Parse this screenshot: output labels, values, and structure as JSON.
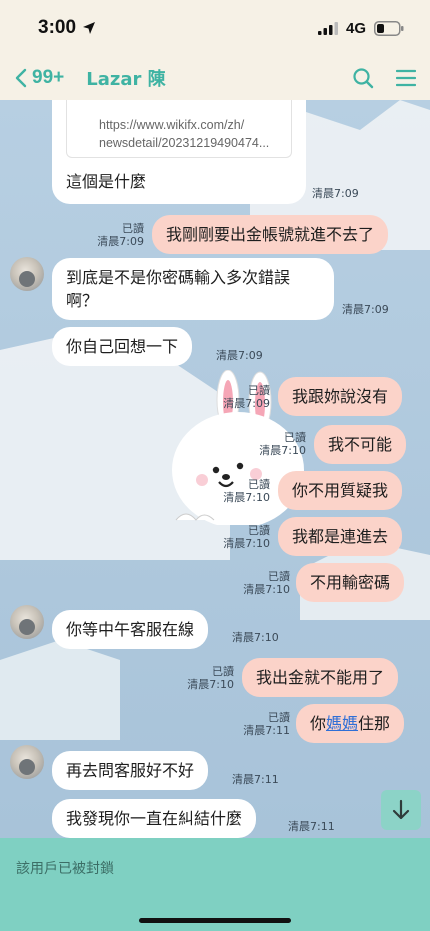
{
  "status_bar": {
    "time": "3:00",
    "network": "4G"
  },
  "header": {
    "back_count": "99+",
    "contact_name": "Lazar 陳"
  },
  "messages": {
    "m1_link1": "https://www.wikifx.com/zh/",
    "m1_link2": "newsdetail/20231219490474...",
    "m1_text": "這個是什麼",
    "m1_time": "清晨7:09",
    "m2_read": "已讀",
    "m2_time": "清晨7:09",
    "m2_text": "我剛剛要出金帳號就進不去了",
    "m3_text_line1": "到底是不是你密碼輸入多次錯誤",
    "m3_text_line2": "啊？",
    "m3_time": "清晨7:09",
    "m4_text": "你自己回想一下",
    "m4_time": "清晨7:09",
    "m5_read": "已讀",
    "m5_time": "清晨7:09",
    "m5_text": "我跟妳說沒有",
    "m6_read": "已讀",
    "m6_time": "清晨7:10",
    "m6_text": "我不可能",
    "m7_read": "已讀",
    "m7_time": "清晨7:10",
    "m7_text": "你不用質疑我",
    "m8_read": "已讀",
    "m8_time": "清晨7:10",
    "m8_text": "我都是連進去",
    "m9_read": "已讀",
    "m9_time": "清晨7:10",
    "m9_text": "不用輸密碼",
    "m10_text": "你等中午客服在線",
    "m10_time": "清晨7:10",
    "m11_read": "已讀",
    "m11_time": "清晨7:10",
    "m11_text": "我出金就不能用了",
    "m12_read": "已讀",
    "m12_time": "清晨7:11",
    "m12_pre": "你",
    "m12_link": "媽媽",
    "m12_post": "住那",
    "m13_text": "再去問客服好不好",
    "m13_time": "清晨7:11",
    "m14_text": "我發現你一直在糾結什麼",
    "m14_time": "清晨7:11"
  },
  "footer": {
    "blocked_text": "該用戶已被封鎖"
  },
  "colors": {
    "accent": "#3fb3a3",
    "outgoing_bubble": "#fbd3c9",
    "incoming_bubble": "#ffffff",
    "footer": "#7fd0c2"
  },
  "icons": [
    "location-arrow-icon",
    "signal-icon",
    "battery-icon",
    "back-chevron-icon",
    "search-icon",
    "menu-icon",
    "scroll-down-icon"
  ]
}
